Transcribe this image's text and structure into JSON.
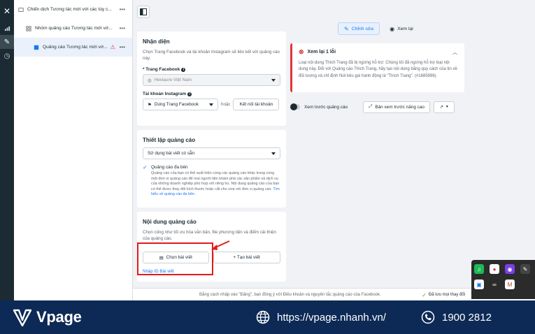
{
  "tree": {
    "campaign": "Chiến dịch Tương tác mới với các tùy c...",
    "adset": "Nhóm quảng cáo Tương tác mới vớ...",
    "ad": "Quảng cáo Tương tác mới vớ...",
    "more": "•••"
  },
  "identity": {
    "title": "Nhận diện",
    "desc": "Chọn Trang Facebook và tài khoản Instagram sẽ liên kết với quảng cáo này.",
    "page_label": "* Trang Facebook",
    "page_value": "Heviaure Việt Nam",
    "ig_label": "Tài khoản Instagram",
    "ig_value": "Dùng Trang Facebook",
    "or": "hoặc",
    "connect": "Kết nối tài khoản"
  },
  "setup": {
    "title": "Thiết lập quảng cáo",
    "select": "Sử dụng bài viết có sẵn",
    "multi_title": "Quảng cáo đa bên",
    "multi_body": "Quảng cáo của bạn có thể xuất hiện cùng các quảng cáo khác trong cùng một đơn vị quảng cáo để mọi người tiện khám phá các sản phẩm và dịch vụ của những doanh nghiệp phù hợp với riêng họ. Nội dung quảng cáo của bạn có thể được thay đổi kích thước hoặc cắt cho vừa với đơn vị quảng cáo.",
    "multi_link": "Tìm hiểu về quảng cáo đa bên"
  },
  "content": {
    "title": "Nội dung quảng cáo",
    "desc": "Chọn cũng như tối ưu hóa văn bản, file phương tiện và điểm cải thiện của quảng cáo.",
    "choose_post": "Chọn bài viết",
    "create_post": "+ Tạo bài viết",
    "enter_id": "Nhập ID Bài viết"
  },
  "preview": {
    "tab_edit": "Chỉnh sửa",
    "tab_review": "Xem lại",
    "error_title": "Xem lại 1 lỗi",
    "error_body": "Loại nội dung Thích Trang đã bị ngừng hỗ trợ: Chúng tôi đã ngừng hỗ trợ loại nội dung này. Đối với Quảng cáo Thích Trang, hãy tạo nội dung bằng quy cách của tin về đối tượng và chỉ định Nút kêu gọi hành động là \"Thích Trang\". (#1885996)",
    "toggle_label": "Xem trước quảng cáo",
    "advanced": "Bản xem trước nâng cao"
  },
  "footer": {
    "consent": "Bằng cách nhấp vào \"Đăng\", bạn đồng ý với Điều khoản và nguyên tắc quảng cáo của Facebook.",
    "saved": "Đã lưu mọi thay đổi"
  },
  "banner": {
    "brand": "Vpage",
    "website": "https://vpage.nhanh.vn/",
    "phone": "1900 2812"
  },
  "colors": {
    "accent": "#1877f2",
    "error": "#e0353d",
    "highlight": "#e21b1b",
    "banner": "#0d2a56"
  }
}
